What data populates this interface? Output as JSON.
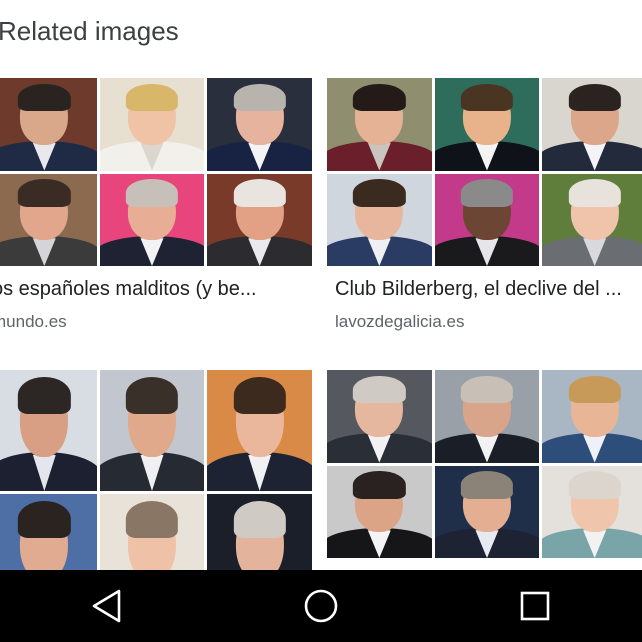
{
  "section_title": "Related images",
  "results": [
    {
      "caption": "os españoles malditos (y be...",
      "source": "mundo.es",
      "tiles": [
        {
          "bg": "#6e3a2c",
          "skin": "#d9a88a",
          "hair": "#2a2421",
          "suit": "#1f2a44",
          "shirt": "#e8e8ee"
        },
        {
          "bg": "#e7dfcf",
          "skin": "#f0c3a6",
          "hair": "#d8b66a",
          "suit": "#f2f0ea",
          "shirt": "#dcd7cc"
        },
        {
          "bg": "#2a2f3d",
          "skin": "#e6b49e",
          "hair": "#b9b3ad",
          "suit": "#182242",
          "shirt": "#f4f4f6"
        },
        {
          "bg": "#8b6a4f",
          "skin": "#e1a68b",
          "hair": "#3a2c24",
          "suit": "#3b3b3b",
          "shirt": "#d5d5d9"
        },
        {
          "bg": "#e9457d",
          "skin": "#e7ae95",
          "hair": "#c7c0b8",
          "suit": "#1e2233",
          "shirt": "#f3f3f5"
        },
        {
          "bg": "#7a3a2a",
          "skin": "#e2a184",
          "hair": "#e9e4df",
          "suit": "#2b2b30",
          "shirt": "#e9e9ee"
        }
      ]
    },
    {
      "caption": "Club Bilderberg, el declive del ...",
      "source": "lavozdegalicia.es",
      "tiles": [
        {
          "bg": "#8f8f70",
          "skin": "#e6b295",
          "hair": "#241a17",
          "suit": "#6b1f2a",
          "shirt": "#c9c4c0"
        },
        {
          "bg": "#2e6d5c",
          "skin": "#e8b38a",
          "hair": "#4a3422",
          "suit": "#10121a",
          "shirt": "#f4f4f4"
        },
        {
          "bg": "#d9d5cf",
          "skin": "#dca68a",
          "hair": "#2b2320",
          "suit": "#222a3c",
          "shirt": "#f4f4f7"
        },
        {
          "bg": "#cfd6dd",
          "skin": "#e7b69c",
          "hair": "#3b2a20",
          "suit": "#2a3c63",
          "shirt": "#eef0f3"
        },
        {
          "bg": "#c43a8a",
          "skin": "#6d4534",
          "hair": "#8a8a8a",
          "suit": "#1a1a1c",
          "shirt": "#e6e6ea"
        },
        {
          "bg": "#5f7d3b",
          "skin": "#efc4ab",
          "hair": "#e7e2dc",
          "suit": "#6a6e72",
          "shirt": "#d8d8dd"
        }
      ]
    },
    {
      "caption": "",
      "source": "",
      "tiles": [
        {
          "bg": "#d8dde4",
          "skin": "#d89f84",
          "hair": "#2c2624",
          "suit": "#1c2030",
          "shirt": "#e3e6ec"
        },
        {
          "bg": "#c2c7cf",
          "skin": "#e0a98c",
          "hair": "#3a302a",
          "suit": "#262a32",
          "shirt": "#f0f0f2"
        },
        {
          "bg": "#d98a46",
          "skin": "#eab79d",
          "hair": "#3c2a1f",
          "suit": "#1e2334",
          "shirt": "#f1f1f3"
        },
        {
          "bg": "#4d6fa6",
          "skin": "#e1ab91",
          "hair": "#2a2320",
          "suit": "#262a36",
          "shirt": "#e9e9ee"
        },
        {
          "bg": "#e8e2d9",
          "skin": "#efc2a7",
          "hair": "#8a7664",
          "suit": "#6e6c73",
          "shirt": "#ddd"
        },
        {
          "bg": "#1b1f29",
          "skin": "#e4b39c",
          "hair": "#cfcac3",
          "suit": "#2a2f3c",
          "shirt": "#eee"
        }
      ]
    },
    {
      "caption": "",
      "source": "",
      "tiles": [
        {
          "bg": "#55595f",
          "skin": "#e5b79f",
          "hair": "#cfcac4",
          "suit": "#2a2e36",
          "shirt": "#f2f2f5"
        },
        {
          "bg": "#9aa0a8",
          "skin": "#d8a58b",
          "hair": "#c8c0b6",
          "suit": "#1a1e26",
          "shirt": "#f2f2f4"
        },
        {
          "bg": "#a9b6c4",
          "skin": "#e8b696",
          "hair": "#c79a5a",
          "suit": "#2d4d7a",
          "shirt": "#eef2f8"
        },
        {
          "bg": "#c9c9c9",
          "skin": "#dca487",
          "hair": "#2a2220",
          "suit": "#161618",
          "shirt": "#f4f4f6"
        },
        {
          "bg": "#1f2f49",
          "skin": "#e3ae91",
          "hair": "#8c8378",
          "suit": "#1d2333",
          "shirt": "#e7eaf0"
        },
        {
          "bg": "#e4e1dc",
          "skin": "#efc6ac",
          "hair": "#dcd5cd",
          "suit": "#7aa5a8",
          "shirt": "#f2f2f2"
        }
      ]
    }
  ],
  "nav": {
    "back_icon": "triangle-back-icon",
    "home_icon": "circle-home-icon",
    "recents_icon": "square-recents-icon",
    "icon_color": "#ffffff",
    "bar_color": "#000000"
  }
}
